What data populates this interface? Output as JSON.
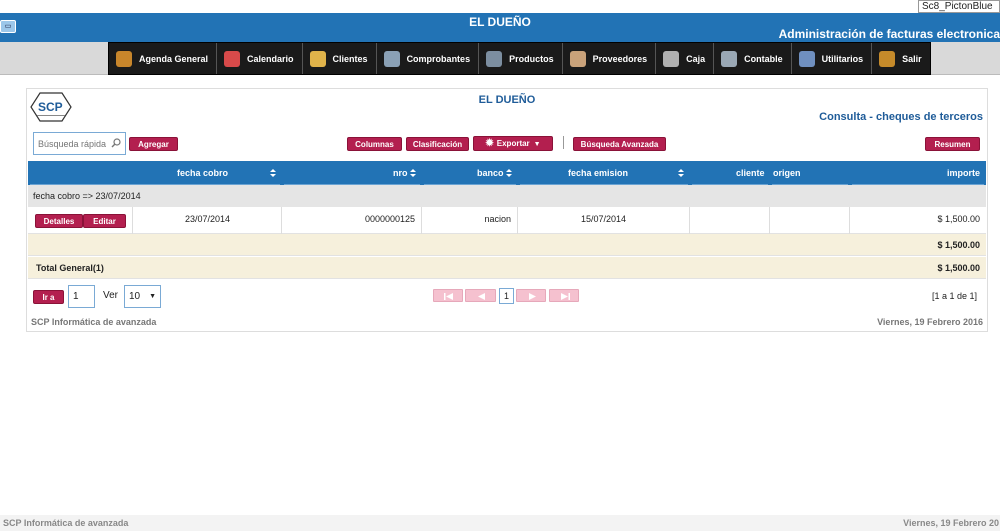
{
  "skin_label": "Sc8_PictonBlue",
  "header": {
    "brand": "EL DUEÑO",
    "subtitle": "Administración de facturas electronica"
  },
  "menu": [
    {
      "label": "Agenda General",
      "icon": "agenda-icon",
      "color": "#c8862b"
    },
    {
      "label": "Calendario",
      "icon": "calendar-icon",
      "color": "#d84a4a"
    },
    {
      "label": "Clientes",
      "icon": "clients-icon",
      "color": "#e0b34a"
    },
    {
      "label": "Comprobantes",
      "icon": "receipts-icon",
      "color": "#8aa0b5"
    },
    {
      "label": "Productos",
      "icon": "products-icon",
      "color": "#7c8ea0"
    },
    {
      "label": "Proveedores",
      "icon": "suppliers-icon",
      "color": "#c9a27a"
    },
    {
      "label": "Caja",
      "icon": "cash-icon",
      "color": "#b0b0b0"
    },
    {
      "label": "Contable",
      "icon": "accounting-icon",
      "color": "#9aa8b5"
    },
    {
      "label": "Utilitarios",
      "icon": "utilities-icon",
      "color": "#6f8fbf"
    },
    {
      "label": "Salir",
      "icon": "exit-icon",
      "color": "#c58a2a"
    }
  ],
  "card": {
    "company": "EL DUEÑO",
    "title": "Consulta - cheques de terceros",
    "search_placeholder": "Búsqueda rápida",
    "buttons": {
      "add": "Agregar",
      "columns": "Columnas",
      "sort": "Clasificación",
      "export": "Exportar",
      "advanced": "Búsqueda Avanzada",
      "summary": "Resumen"
    }
  },
  "table": {
    "columns": [
      "fecha cobro",
      "nro",
      "banco",
      "fecha emision",
      "cliente",
      "origen",
      "importe"
    ],
    "group_label": "fecha cobro => 23/07/2014",
    "row_buttons": {
      "details": "Detalles",
      "edit": "Editar"
    },
    "rows": [
      {
        "fecha_cobro": "23/07/2014",
        "nro": "0000000125",
        "banco": "nacion",
        "fecha_emision": "15/07/2014",
        "cliente": "",
        "origen": "",
        "importe": "$ 1,500.00"
      }
    ],
    "subtotal": "$ 1,500.00",
    "total_label": "Total General(1)",
    "total": "$ 1,500.00"
  },
  "pagination": {
    "go_label": "Ir a",
    "go_value": "1",
    "view_label": "Ver",
    "page_size": "10",
    "current_page": "1",
    "range": "[1 a 1 de 1]"
  },
  "footer": {
    "company": "SCP Informática de avanzada",
    "date": "Viernes, 19 Febrero 2016"
  },
  "bottom": {
    "company": "SCP Informática de avanzada",
    "date": "Viernes, 19 Febrero 20"
  },
  "colors": {
    "accent_blue": "#2273b5",
    "button_crimson": "#b31f4f",
    "pager_pink": "#f5c1cf",
    "subtotal_bg": "#f6f0dc"
  }
}
